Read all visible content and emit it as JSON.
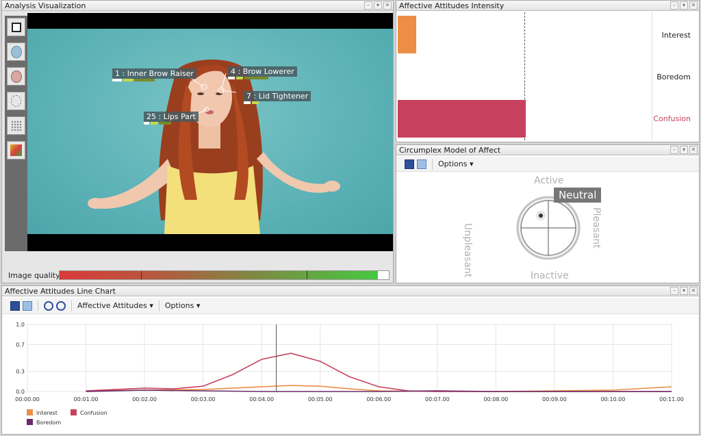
{
  "analysis": {
    "title": "Analysis Visualization",
    "tools": [
      "square-tool-icon",
      "face-mesh-icon",
      "face-icon",
      "face-outline-icon",
      "landmarks-icon",
      "heatmap-icon"
    ],
    "action_units": [
      {
        "label": "1 : Inner Brow Raiser"
      },
      {
        "label": "4 : Brow Lowerer"
      },
      {
        "label": "7 : Lid Tightener"
      },
      {
        "label": "25 : Lips Part"
      }
    ],
    "image_quality_label": "Image quality"
  },
  "intensity": {
    "title": "Affective Attitudes Intensity",
    "rows": [
      {
        "label": "Interest",
        "value": 0.1,
        "color": "#ec8e45"
      },
      {
        "label": "Boredom",
        "value": 0.0,
        "color": "#6b2a6b"
      },
      {
        "label": "Confusion",
        "value": 0.7,
        "color": "#c7415e"
      }
    ]
  },
  "circumplex": {
    "title": "Circumplex Model of Affect",
    "options_label": "Options",
    "active": "Active",
    "inactive": "Inactive",
    "pleasant": "Pleasant",
    "unpleasant": "Unpleasant",
    "state": "Neutral"
  },
  "linechart": {
    "title": "Affective Attitudes Line Chart",
    "affective_label": "Affective Attitudes",
    "options_label": "Options"
  },
  "chart_data": {
    "type": "line",
    "x": [
      "00:00.00",
      "00:01.00",
      "00:02.00",
      "00:03.00",
      "00:04.00",
      "00:05.00",
      "00:06.00",
      "00:07.00",
      "00:08.00",
      "00:09.00",
      "00:10.00",
      "00:11.00"
    ],
    "ylim": [
      0,
      1.0
    ],
    "yticks": [
      "1.0",
      "0.7",
      "0.3",
      "0.0"
    ],
    "cursor_time": 4.25,
    "series": [
      {
        "name": "Interest",
        "color": "#ec8e45",
        "points": [
          [
            1,
            0.01
          ],
          [
            2,
            0.02
          ],
          [
            3,
            0.03
          ],
          [
            3.5,
            0.05
          ],
          [
            4,
            0.07
          ],
          [
            4.5,
            0.09
          ],
          [
            5,
            0.08
          ],
          [
            5.5,
            0.04
          ],
          [
            6,
            0.01
          ],
          [
            7,
            0.0
          ],
          [
            8,
            0.0
          ],
          [
            9,
            0.01
          ],
          [
            10,
            0.02
          ],
          [
            11,
            0.07
          ]
        ]
      },
      {
        "name": "Confusion",
        "color": "#c7415e",
        "points": [
          [
            1,
            0.01
          ],
          [
            1.5,
            0.03
          ],
          [
            2,
            0.05
          ],
          [
            2.5,
            0.04
          ],
          [
            3,
            0.08
          ],
          [
            3.5,
            0.25
          ],
          [
            4,
            0.48
          ],
          [
            4.5,
            0.57
          ],
          [
            5,
            0.45
          ],
          [
            5.5,
            0.22
          ],
          [
            6,
            0.07
          ],
          [
            6.5,
            0.01
          ],
          [
            7,
            0.0
          ],
          [
            8,
            0.0
          ],
          [
            9,
            0.0
          ],
          [
            10,
            0.0
          ],
          [
            11,
            0.0
          ]
        ]
      },
      {
        "name": "Boredom",
        "color": "#6b2a6b",
        "points": [
          [
            1,
            0.0
          ],
          [
            2,
            0.02
          ],
          [
            3,
            0.01
          ],
          [
            4,
            0.0
          ],
          [
            5,
            0.0
          ],
          [
            6,
            0.0
          ],
          [
            7,
            0.01
          ],
          [
            8,
            0.0
          ],
          [
            9,
            0.0
          ],
          [
            10,
            0.0
          ],
          [
            11,
            0.0
          ]
        ]
      }
    ]
  }
}
